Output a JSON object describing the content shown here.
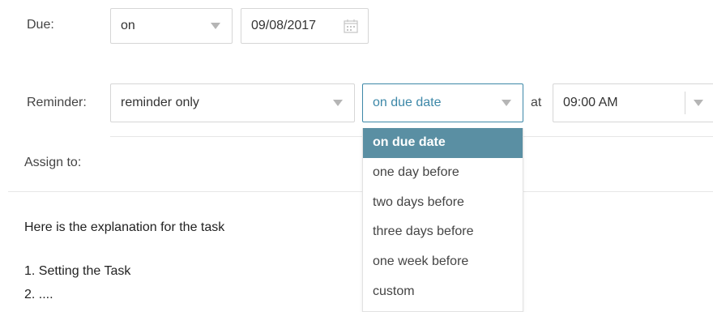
{
  "due": {
    "label": "Due:",
    "mode": "on",
    "date": "09/08/2017"
  },
  "reminder": {
    "label": "Reminder:",
    "type": "reminder only",
    "when": "on due date",
    "at_label": "at",
    "time": "09:00 AM",
    "options": [
      "on due date",
      "one day before",
      "two days before",
      "three days before",
      "one week before",
      "custom"
    ]
  },
  "assign": {
    "label": "Assign to:"
  },
  "description": {
    "line1": "Here is the explanation for the task",
    "line2": "1.  Setting the Task",
    "line3": "2. ...."
  },
  "colors": {
    "accent": "#3d88a8",
    "selected_option_bg": "#5a8fa3",
    "border": "#d6d6d6"
  }
}
